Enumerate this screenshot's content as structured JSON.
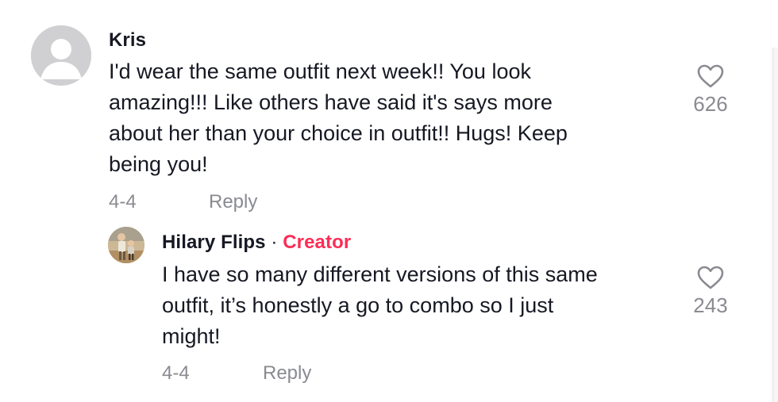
{
  "comments": [
    {
      "username": "Kris",
      "text_lines": [
        "I'd wear the same outfit next week!! You look",
        "amazing!!! Like others have said it's says more",
        "about her than your choice in outfit!! Hugs! Keep",
        "being you!"
      ],
      "date": "4-4",
      "reply_label": "Reply",
      "likes": "626",
      "avatar_icon": "default-user-avatar-icon"
    },
    {
      "username": "Hilary Flips",
      "separator": "·",
      "badge": "Creator",
      "text_lines": [
        "I have so many different versions of this same",
        "outfit, it’s honestly a go to combo so I just",
        "might!"
      ],
      "date": "4-4",
      "reply_label": "Reply",
      "likes": "243",
      "avatar_icon": "user-photo-avatar"
    }
  ],
  "colors": {
    "text": "#161823",
    "muted": "#8a8b91",
    "creator_badge": "#fe2c55",
    "avatar_placeholder": "#d0d0d2"
  },
  "icons": {
    "like": "heart-outline-icon"
  }
}
